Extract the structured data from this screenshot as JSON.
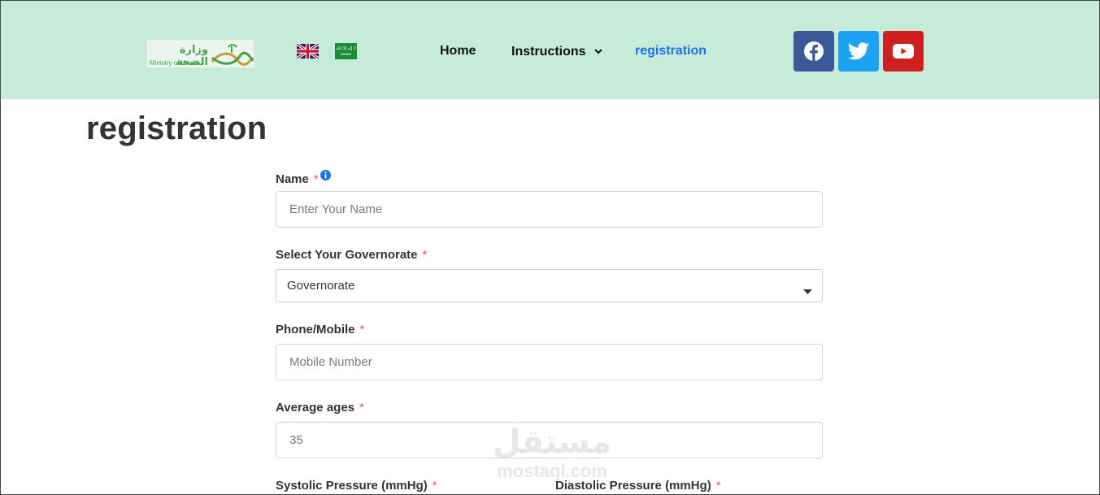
{
  "header": {
    "logo": {
      "arabic_text": "وزارة الصحة",
      "english_text": "Ministry of Health",
      "icon": "ministry-logo-icon"
    },
    "languages": [
      {
        "icon": "uk-flag-icon"
      },
      {
        "icon": "saudi-flag-icon",
        "flag_text": "لا إله إلا الله"
      }
    ],
    "nav": {
      "home": "Home",
      "instructions": "Instructions",
      "registration": "registration"
    },
    "social": [
      {
        "icon": "facebook-icon",
        "color": "#3b5998"
      },
      {
        "icon": "twitter-icon",
        "color": "#1da1f2"
      },
      {
        "icon": "youtube-icon",
        "color": "#cd201f"
      }
    ],
    "background_color": "#c6ebd8",
    "active_color": "#1a73e8"
  },
  "page": {
    "title": "registration"
  },
  "form": {
    "name": {
      "label": "Name",
      "required": "*",
      "placeholder": "Enter Your Name",
      "value": ""
    },
    "governorate": {
      "label": "Select Your Governorate",
      "required": "*",
      "selected": "Governorate"
    },
    "phone": {
      "label": "Phone/Mobile",
      "required": "*",
      "placeholder": "Mobile Number",
      "value": ""
    },
    "age": {
      "label": "Average ages",
      "required": "*",
      "placeholder": "35",
      "value": ""
    },
    "systolic": {
      "label": "Systolic Pressure (mmHg)",
      "required": "*"
    },
    "diastolic": {
      "label": "Diastolic Pressure (mmHg)",
      "required": "*"
    }
  },
  "watermark": {
    "arabic": "مستقل",
    "english": "mostaql.com"
  }
}
